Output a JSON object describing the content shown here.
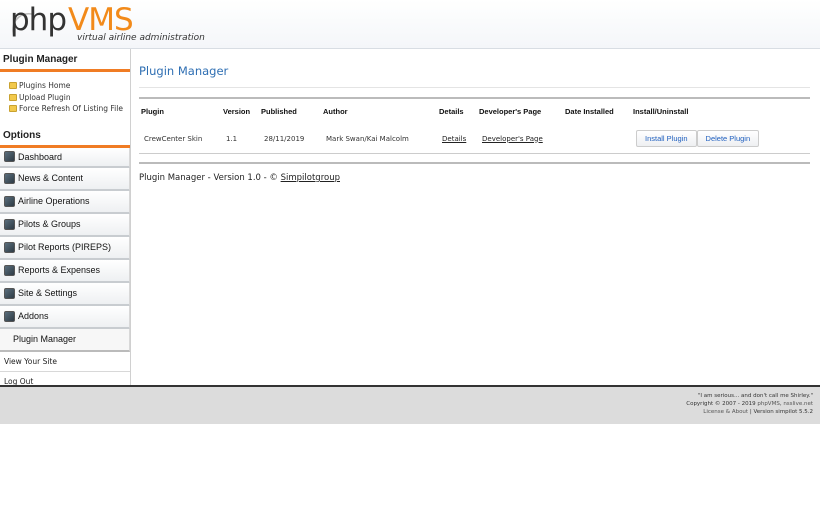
{
  "header": {
    "logo_php": "php",
    "logo_vms": "VMS",
    "logo_tagline": "virtual airline administration"
  },
  "sidebar": {
    "plugin_heading": "Plugin Manager",
    "plugin_links": [
      {
        "label": "Plugins Home",
        "icon": "folder-icon"
      },
      {
        "label": "Upload Plugin",
        "icon": "folder-icon"
      },
      {
        "label": "Force Refresh Of Listing File",
        "icon": "folder-icon"
      }
    ],
    "options_heading": "Options",
    "nav": [
      {
        "label": "Dashboard",
        "icon": "dashboard-icon"
      },
      {
        "label": "News & Content",
        "icon": "news-icon"
      },
      {
        "label": "Airline Operations",
        "icon": "airline-icon"
      },
      {
        "label": "Pilots & Groups",
        "icon": "pilots-icon"
      },
      {
        "label": "Pilot Reports (PIREPS)",
        "icon": "pireps-icon"
      },
      {
        "label": "Reports & Expenses",
        "icon": "reports-icon"
      },
      {
        "label": "Site & Settings",
        "icon": "settings-icon"
      },
      {
        "label": "Addons",
        "icon": "addons-icon"
      },
      {
        "label": "Plugin Manager"
      }
    ],
    "view_site": "View Your Site",
    "log_out": "Log Out"
  },
  "main": {
    "title": "Plugin Manager",
    "table": {
      "headers": [
        "Plugin",
        "Version",
        "Published",
        "Author",
        "Details",
        "Developer's Page",
        "Date Installed",
        "Install/Uninstall"
      ],
      "rows": [
        {
          "plugin": "CrewCenter Skin",
          "version": "1.1",
          "published": "28/11/2019",
          "author": "Mark Swan/Kai Malcolm",
          "details": "Details",
          "developer_page": "Developer's Page",
          "date_installed": "",
          "install_label": "Install Plugin",
          "delete_label": "Delete Plugin"
        }
      ]
    },
    "version_prefix": "Plugin Manager - Version 1.0 - © ",
    "version_link": "Simpilotgroup"
  },
  "footer": {
    "quote": "\"I am serious... and don't call me Shirley.\"",
    "copyright_prefix": "Copyright © 2007 - 2019 ",
    "copyright_phpvms": "phpVMS",
    "copyright_sep": ", ",
    "copyright_nsslive": "nsslive.net",
    "license": "License & About",
    "version_sep": " | ",
    "version": "Version simpilot 5.5.2"
  },
  "colors": {
    "accent": "#f07c24",
    "title_blue": "#2f6fb3",
    "button_text": "#1f5fbf",
    "footer_bg": "#dcdcdc"
  }
}
